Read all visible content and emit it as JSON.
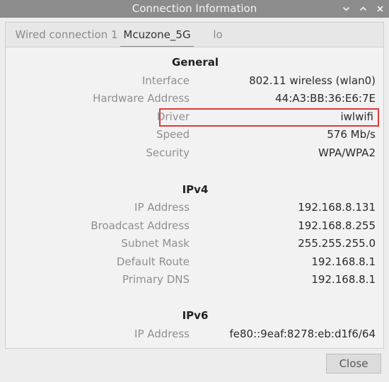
{
  "window": {
    "title": "Connection Information"
  },
  "tabs": [
    {
      "label": "Wired connection 1"
    },
    {
      "label": "Mcuzone_5G"
    },
    {
      "label": "lo"
    }
  ],
  "general": {
    "title": "General",
    "rows": [
      {
        "label": "Interface",
        "value": "802.11 wireless (wlan0)"
      },
      {
        "label": "Hardware Address",
        "value": "44:A3:BB:36:E6:7E"
      },
      {
        "label": "Driver",
        "value": "iwlwifi"
      },
      {
        "label": "Speed",
        "value": "576 Mb/s"
      },
      {
        "label": "Security",
        "value": "WPA/WPA2"
      }
    ]
  },
  "ipv4": {
    "title": "IPv4",
    "rows": [
      {
        "label": "IP Address",
        "value": "192.168.8.131"
      },
      {
        "label": "Broadcast Address",
        "value": "192.168.8.255"
      },
      {
        "label": "Subnet Mask",
        "value": "255.255.255.0"
      },
      {
        "label": "Default Route",
        "value": "192.168.8.1"
      },
      {
        "label": "Primary DNS",
        "value": "192.168.8.1"
      }
    ]
  },
  "ipv6": {
    "title": "IPv6",
    "rows": [
      {
        "label": "IP Address",
        "value": "fe80::9eaf:8278:eb:d1f6/64"
      }
    ]
  },
  "footer": {
    "close_label": "Close"
  },
  "colors": {
    "highlight": "#e03a3a",
    "titlebar": "#8c8c8c"
  },
  "icons": [
    "chevron-down-icon",
    "chevron-up-icon",
    "close-icon"
  ]
}
